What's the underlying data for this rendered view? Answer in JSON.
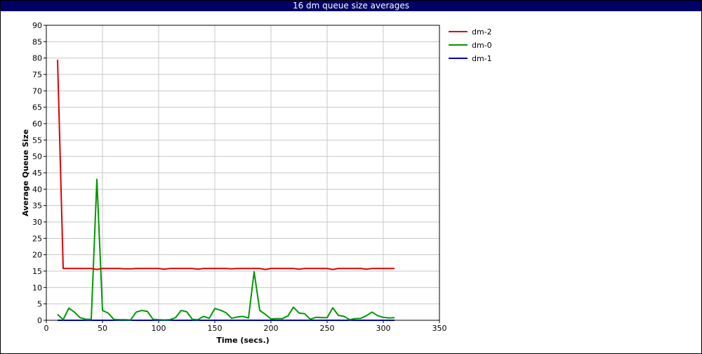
{
  "window": {
    "title": "16 dm queue size averages",
    "title_bar_color": "#000066"
  },
  "chart_data": {
    "type": "line",
    "title": "16 dm queue size averages",
    "xlabel": "Time (secs.)",
    "ylabel": "Average Queue Size",
    "xlim": [
      0,
      350
    ],
    "ylim": [
      0,
      90
    ],
    "xticks": [
      0,
      50,
      100,
      150,
      200,
      250,
      300,
      350
    ],
    "yticks": [
      0,
      5,
      10,
      15,
      20,
      25,
      30,
      35,
      40,
      45,
      50,
      55,
      60,
      65,
      70,
      75,
      80,
      85,
      90
    ],
    "grid": true,
    "legend_position": "right",
    "series": [
      {
        "name": "dm-2",
        "color": "#dd0000",
        "x": [
          10,
          15,
          20,
          25,
          30,
          35,
          40,
          45,
          50,
          55,
          60,
          65,
          70,
          75,
          80,
          85,
          90,
          95,
          100,
          105,
          110,
          115,
          120,
          125,
          130,
          135,
          140,
          145,
          150,
          155,
          160,
          165,
          170,
          175,
          180,
          185,
          190,
          195,
          200,
          205,
          210,
          215,
          220,
          225,
          230,
          235,
          240,
          245,
          250,
          255,
          260,
          265,
          270,
          275,
          280,
          285,
          290,
          295,
          300,
          305,
          310
        ],
        "y": [
          79.5,
          15.8,
          15.8,
          15.8,
          15.8,
          15.8,
          15.8,
          15.5,
          15.8,
          15.8,
          15.8,
          15.8,
          15.7,
          15.7,
          15.8,
          15.8,
          15.8,
          15.8,
          15.8,
          15.6,
          15.8,
          15.8,
          15.8,
          15.8,
          15.8,
          15.6,
          15.8,
          15.8,
          15.8,
          15.8,
          15.8,
          15.7,
          15.8,
          15.8,
          15.8,
          15.8,
          15.8,
          15.5,
          15.8,
          15.8,
          15.8,
          15.8,
          15.8,
          15.6,
          15.8,
          15.8,
          15.8,
          15.8,
          15.8,
          15.5,
          15.8,
          15.8,
          15.8,
          15.8,
          15.8,
          15.6,
          15.8,
          15.8,
          15.8,
          15.8,
          15.8
        ]
      },
      {
        "name": "dm-0",
        "color": "#009900",
        "x": [
          10,
          15,
          20,
          25,
          30,
          35,
          40,
          45,
          50,
          55,
          60,
          65,
          70,
          75,
          80,
          85,
          90,
          95,
          100,
          105,
          110,
          115,
          120,
          125,
          130,
          135,
          140,
          145,
          150,
          155,
          160,
          165,
          170,
          175,
          180,
          185,
          190,
          195,
          200,
          205,
          210,
          215,
          220,
          225,
          230,
          235,
          240,
          245,
          250,
          255,
          260,
          265,
          270,
          275,
          280,
          285,
          290,
          295,
          300,
          305,
          310
        ],
        "y": [
          1.8,
          0.2,
          3.7,
          2.5,
          0.8,
          0.3,
          0.3,
          43.0,
          3.0,
          2.2,
          0.3,
          0.2,
          0.2,
          0.1,
          2.5,
          3.0,
          2.7,
          0.3,
          0.2,
          0.1,
          0.2,
          0.8,
          3.0,
          2.6,
          0.3,
          0.2,
          1.2,
          0.6,
          3.6,
          3.1,
          2.3,
          0.6,
          1.0,
          1.2,
          0.7,
          14.8,
          3.0,
          1.8,
          0.4,
          0.5,
          0.5,
          1.3,
          4.0,
          2.2,
          2.0,
          0.3,
          0.9,
          0.8,
          0.8,
          3.8,
          1.5,
          1.2,
          0.2,
          0.5,
          0.6,
          1.4,
          2.5,
          1.4,
          0.9,
          0.7,
          0.8
        ]
      },
      {
        "name": "dm-1",
        "color": "#0000bb",
        "x": [
          10,
          310
        ],
        "y": [
          0,
          0
        ]
      }
    ]
  }
}
